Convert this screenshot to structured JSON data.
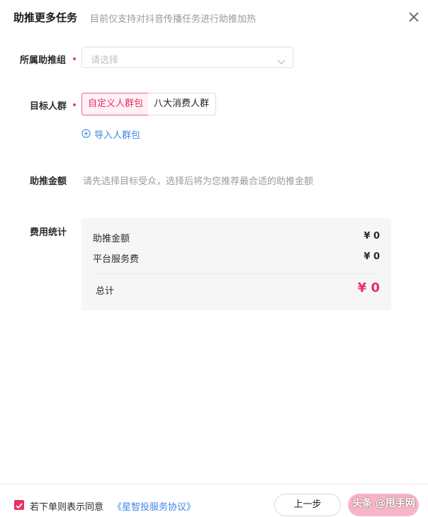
{
  "header": {
    "title": "助推更多任务",
    "subtitle": "目前仅支持对抖音传播任务进行助推加热"
  },
  "form": {
    "group": {
      "label": "所属助推组",
      "placeholder": "请选择"
    },
    "audience": {
      "label": "目标人群",
      "options": [
        "自定义人群包",
        "八大消费人群"
      ],
      "selected": "自定义人群包",
      "import_link": "导入人群包"
    },
    "amount": {
      "label": "助推金额",
      "hint": "请先选择目标受众，选择后将为您推荐最合适的助推金额"
    },
    "fees": {
      "label": "费用统计",
      "rows": [
        {
          "label": "助推金额",
          "value": "¥ 0"
        },
        {
          "label": "平台服务费",
          "value": "¥ 0"
        }
      ],
      "total_label": "总计",
      "total_value": "¥ 0"
    }
  },
  "footer": {
    "agree_text": "若下单则表示同意",
    "agreement_link": "《星智投服务协议》",
    "agree_checked": true,
    "prev_label": "上一步",
    "watermark": "头条 @甩手网"
  },
  "colors": {
    "accent": "#ea2f63",
    "link": "#3d86e8",
    "next_button": "#f7b6c8"
  },
  "icons": {
    "close": "close-icon",
    "dropdown": "chevron-down-icon",
    "import": "plus-circle-icon",
    "check": "check-icon"
  }
}
